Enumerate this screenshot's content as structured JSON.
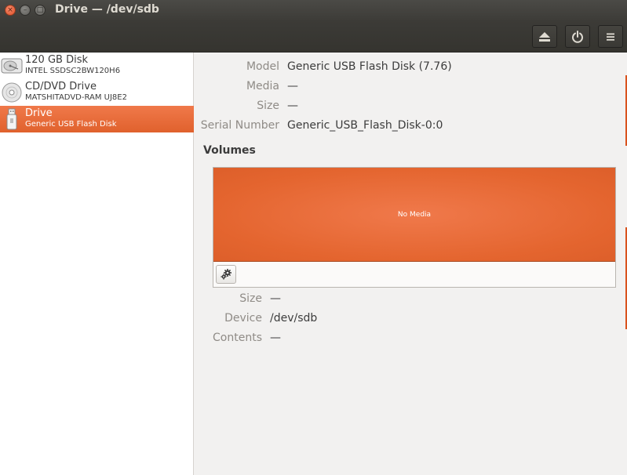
{
  "window": {
    "title": "Drive — /dev/sdb",
    "close_glyph": "×",
    "min_glyph": "–",
    "max_glyph": "□"
  },
  "header": {
    "buttons": [
      {
        "icon": "eject-icon"
      },
      {
        "icon": "power-icon"
      },
      {
        "icon": "menu-icon"
      }
    ]
  },
  "sidebar": {
    "items": [
      {
        "name": "120 GB Disk",
        "subtitle": "INTEL SSDSC2BW120H6",
        "icon": "hard-disk-icon",
        "selected": false
      },
      {
        "name": "CD/DVD Drive",
        "subtitle": "MATSHITADVD-RAM UJ8E2",
        "icon": "optical-disc-icon",
        "selected": false
      },
      {
        "name": "Drive",
        "subtitle": "Generic USB Flash Disk",
        "icon": "usb-drive-icon",
        "selected": true
      }
    ]
  },
  "drive_props": {
    "model_label": "Model",
    "model_value": "Generic USB Flash Disk (7.76)",
    "media_label": "Media",
    "media_value": "—",
    "size_label": "Size",
    "size_value": "—",
    "serial_label": "Serial Number",
    "serial_value": "Generic_USB_Flash_Disk-0:0"
  },
  "volumes": {
    "title": "Volumes",
    "bar_text": "No Media",
    "bar_color": "#e4652f"
  },
  "volume_props": {
    "size_label": "Size",
    "size_value": "—",
    "device_label": "Device",
    "device_value": "/dev/sdb",
    "contents_label": "Contents",
    "contents_value": "—"
  },
  "colors": {
    "accent": "#e0612d",
    "titlebar": "#3c3b37"
  }
}
